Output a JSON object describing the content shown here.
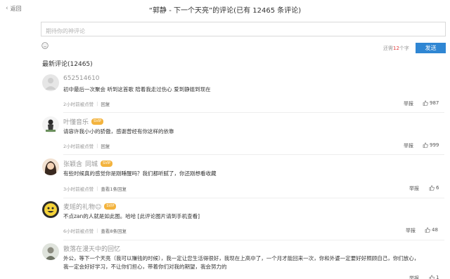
{
  "header": {
    "back_label": "返回",
    "title": "“郭静 - 下一个天亮”的评论(已有 12465 条评论)"
  },
  "composer": {
    "placeholder": "期待你的神评论",
    "limit_prefix": "还需",
    "limit_count": "12",
    "limit_suffix": "个字",
    "send_label": "发送"
  },
  "latest_title": "最新评论(12465)",
  "comments": [
    {
      "user": "652514610",
      "text": "初中最后一次聚会 听到这首歌 陪着我走过伤心 爱到静姐到现在",
      "time": "2小时前被点赞",
      "reply": "回复",
      "report": "举报",
      "likes": "987"
    },
    {
      "user": "叶懂音乐",
      "badge": "SVIP",
      "text": "请容许我小小的骄傲，感谢曾经有你这样的依靠",
      "time": "2小时前被点赞",
      "reply": "回复",
      "report": "举报",
      "likes": "999"
    },
    {
      "user": "张颖含",
      "location": "同城",
      "badge": "SVIP",
      "text": "有些时候真的感觉你是刚睡醒吗？我们都听腻了，你还刚想看收藏",
      "time": "3小时前被点赞",
      "reply": "查看1条回复",
      "report": "举报",
      "likes": "6"
    },
    {
      "user": "麦瑶的礼物☺",
      "badge": "SVIP",
      "text": "不点zan的人就是如此图。哈哈 [此评论图片请到手机查看]",
      "time": "6小时前被点赞",
      "reply": "查看8条回复",
      "report": "举报",
      "likes": "48"
    },
    {
      "user": "散落在漫天中的回忆",
      "text_line1": "外公，等下一个天亮（我可以赚钱的时候），我一定让您生活得很好，我现在上高中了，一个月才能回来一次，你和外婆一定要好好照顾自己，你们放心，",
      "text_line2": "我一定会好好学习，不让你们担心，带着你们对我的期望，我会努力的",
      "report": "举报",
      "likes": "1"
    }
  ]
}
